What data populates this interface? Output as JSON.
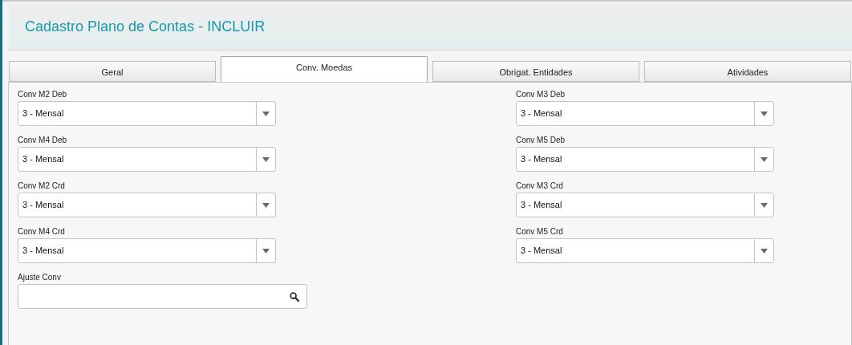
{
  "header": {
    "title": "Cadastro Plano de Contas - INCLUIR"
  },
  "tabs": [
    {
      "label": "Geral",
      "selected": false
    },
    {
      "label": "Conv. Moedas",
      "selected": true
    },
    {
      "label": "Obrigat. Entidades",
      "selected": false
    },
    {
      "label": "Atividades",
      "selected": false
    }
  ],
  "fields": [
    {
      "kind": "select",
      "label": "Conv M2 Deb",
      "value": "3 - Mensal"
    },
    {
      "kind": "select",
      "label": "Conv M3 Deb",
      "value": "3 - Mensal"
    },
    {
      "kind": "select",
      "label": "Conv M4 Deb",
      "value": "3 - Mensal"
    },
    {
      "kind": "select",
      "label": "Conv M5 Deb",
      "value": "3 - Mensal"
    },
    {
      "kind": "select",
      "label": "Conv M2 Crd",
      "value": "3 - Mensal"
    },
    {
      "kind": "select",
      "label": "Conv M3 Crd",
      "value": "3 - Mensal"
    },
    {
      "kind": "select",
      "label": "Conv M4 Crd",
      "value": "3 - Mensal"
    },
    {
      "kind": "select",
      "label": "Conv M5 Crd",
      "value": "3 - Mensal"
    },
    {
      "kind": "lookup",
      "label": "Ajuste Conv"
    }
  ]
}
